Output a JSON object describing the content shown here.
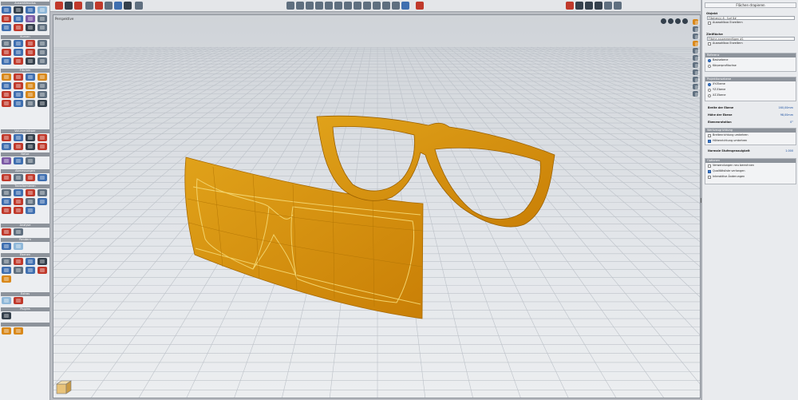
{
  "viewport": {
    "name": "Perspektive"
  },
  "left_toolbox": {
    "sections": [
      "Auswahlmodus",
      "Kurven",
      "Flächen",
      "Volumenkörper",
      "Netze",
      "Abmessungen",
      "Transformieren",
      "Analyse",
      "Rendern",
      "Ebenen",
      "Extras",
      "Plugins"
    ]
  },
  "panel": {
    "title": "Flächen drapieren",
    "objekt_label": "Objekt",
    "objekt_value": "Flächen(s) 8 - Surf 8#",
    "objekt_check": "Auswahlbox Erweitern",
    "zielflaeche_label": "Zielfläche",
    "zielflaeche_value": "Fläche zusammenfügen #1",
    "zielflaeche_check": "Auswahlbox Erweitern",
    "referenz_head": "Referenz",
    "referenz_opt1": "Basisebene",
    "referenz_opt2": "Körperprofilachse",
    "projektion_head": "Projektionsebene",
    "proj_opt1": "XY-Ebene",
    "proj_opt2": "YZ-Ebene",
    "proj_opt3": "XZ-Ebene",
    "breite_label": "Breite der Ebene",
    "breite_value": "160,00mm",
    "hoehe_label": "Höhe der Ebene",
    "hoehe_value": "98,00mm",
    "orient_label": "Ebenenrotation",
    "orient_value": "0°",
    "werkz_head": "Werkzeugrichtung",
    "werkz_opt1": "Breitenrichtung umkehren",
    "werkz_opt2": "Höhenrichtung umkehren",
    "normal_label": "Normale Stufengenauigkeit",
    "normal_value": "1.000",
    "optionen_head": "Optionen",
    "opt1": "Verwendungen neu berechnen",
    "opt2": "Qualitätsliste verlangen",
    "opt3": "Interaktive Änderungen"
  }
}
